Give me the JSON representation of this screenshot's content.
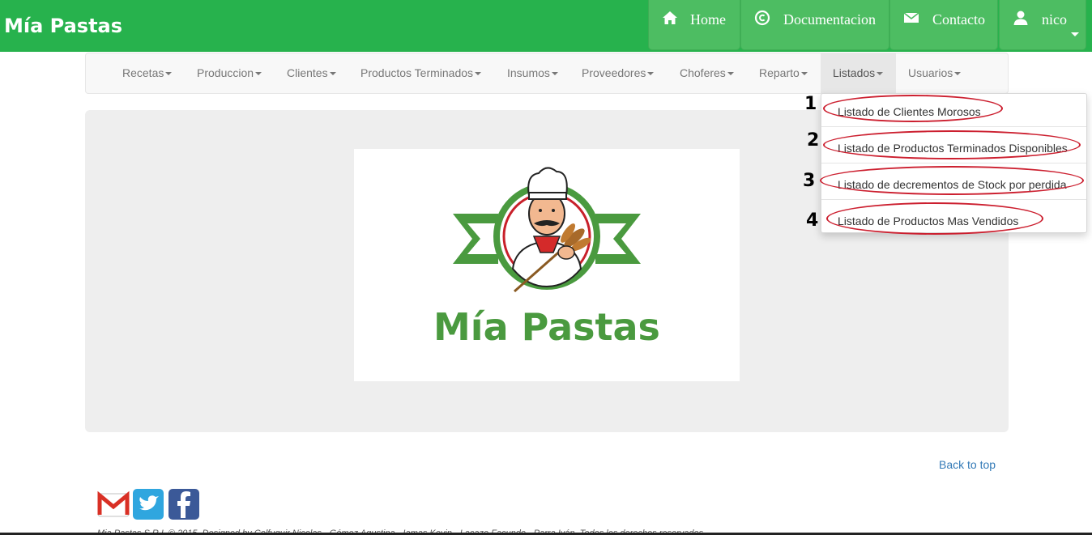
{
  "brand": "Mía Pastas",
  "top_nav": [
    {
      "label": "Home",
      "icon": "home-icon"
    },
    {
      "label": "Documentacion",
      "icon": "copyright-icon"
    },
    {
      "label": "Contacto",
      "icon": "envelope-icon"
    },
    {
      "label": "nico",
      "icon": "user-icon"
    }
  ],
  "menu": [
    {
      "label": "Recetas"
    },
    {
      "label": "Produccion"
    },
    {
      "label": "Clientes"
    },
    {
      "label": "Productos Terminados"
    },
    {
      "label": "Insumos"
    },
    {
      "label": "Proveedores"
    },
    {
      "label": "Choferes"
    },
    {
      "label": "Reparto"
    },
    {
      "label": "Listados",
      "active": true
    },
    {
      "label": "Usuarios"
    }
  ],
  "dropdown": {
    "items": [
      {
        "number": "1",
        "label": "Listado de Clientes Morosos"
      },
      {
        "number": "2",
        "label": "Listado de Productos Terminados Disponibles"
      },
      {
        "number": "3",
        "label": "Listado de decrementos de Stock por perdida"
      },
      {
        "number": "4",
        "label": "Listado de Productos Mas Vendidos"
      }
    ]
  },
  "logo_text": "Mía Pastas",
  "back_to_top": "Back to top",
  "footer": {
    "text": "Mia Pastas S.R.L © 2015. Designed by Colfuquir Nicolas - Gómez Agustina - Iamas Kevin - Lacaze Facundo - Parra Iván. Todos los derechos reservados."
  },
  "colors": {
    "brand_green": "#27b24d",
    "button_green": "#4dbd62",
    "annotation_red": "#cc1f2f",
    "link_blue": "#337ab7"
  }
}
